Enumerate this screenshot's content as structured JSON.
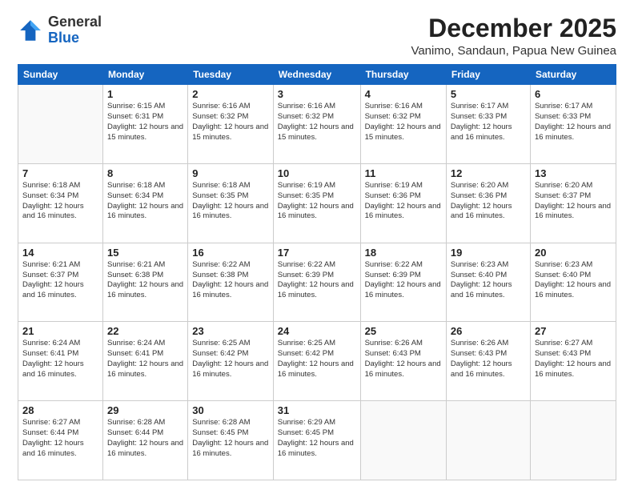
{
  "logo": {
    "general": "General",
    "blue": "Blue"
  },
  "header": {
    "month": "December 2025",
    "location": "Vanimo, Sandaun, Papua New Guinea"
  },
  "days_of_week": [
    "Sunday",
    "Monday",
    "Tuesday",
    "Wednesday",
    "Thursday",
    "Friday",
    "Saturday"
  ],
  "weeks": [
    [
      {
        "day": "",
        "info": ""
      },
      {
        "day": "1",
        "info": "Sunrise: 6:15 AM\nSunset: 6:31 PM\nDaylight: 12 hours\nand 15 minutes."
      },
      {
        "day": "2",
        "info": "Sunrise: 6:16 AM\nSunset: 6:32 PM\nDaylight: 12 hours\nand 15 minutes."
      },
      {
        "day": "3",
        "info": "Sunrise: 6:16 AM\nSunset: 6:32 PM\nDaylight: 12 hours\nand 15 minutes."
      },
      {
        "day": "4",
        "info": "Sunrise: 6:16 AM\nSunset: 6:32 PM\nDaylight: 12 hours\nand 15 minutes."
      },
      {
        "day": "5",
        "info": "Sunrise: 6:17 AM\nSunset: 6:33 PM\nDaylight: 12 hours\nand 16 minutes."
      },
      {
        "day": "6",
        "info": "Sunrise: 6:17 AM\nSunset: 6:33 PM\nDaylight: 12 hours\nand 16 minutes."
      }
    ],
    [
      {
        "day": "7",
        "info": ""
      },
      {
        "day": "8",
        "info": "Sunrise: 6:18 AM\nSunset: 6:34 PM\nDaylight: 12 hours\nand 16 minutes."
      },
      {
        "day": "9",
        "info": "Sunrise: 6:18 AM\nSunset: 6:35 PM\nDaylight: 12 hours\nand 16 minutes."
      },
      {
        "day": "10",
        "info": "Sunrise: 6:19 AM\nSunset: 6:35 PM\nDaylight: 12 hours\nand 16 minutes."
      },
      {
        "day": "11",
        "info": "Sunrise: 6:19 AM\nSunset: 6:36 PM\nDaylight: 12 hours\nand 16 minutes."
      },
      {
        "day": "12",
        "info": "Sunrise: 6:20 AM\nSunset: 6:36 PM\nDaylight: 12 hours\nand 16 minutes."
      },
      {
        "day": "13",
        "info": "Sunrise: 6:20 AM\nSunset: 6:37 PM\nDaylight: 12 hours\nand 16 minutes."
      }
    ],
    [
      {
        "day": "14",
        "info": ""
      },
      {
        "day": "15",
        "info": "Sunrise: 6:21 AM\nSunset: 6:38 PM\nDaylight: 12 hours\nand 16 minutes."
      },
      {
        "day": "16",
        "info": "Sunrise: 6:22 AM\nSunset: 6:38 PM\nDaylight: 12 hours\nand 16 minutes."
      },
      {
        "day": "17",
        "info": "Sunrise: 6:22 AM\nSunset: 6:39 PM\nDaylight: 12 hours\nand 16 minutes."
      },
      {
        "day": "18",
        "info": "Sunrise: 6:22 AM\nSunset: 6:39 PM\nDaylight: 12 hours\nand 16 minutes."
      },
      {
        "day": "19",
        "info": "Sunrise: 6:23 AM\nSunset: 6:40 PM\nDaylight: 12 hours\nand 16 minutes."
      },
      {
        "day": "20",
        "info": "Sunrise: 6:23 AM\nSunset: 6:40 PM\nDaylight: 12 hours\nand 16 minutes."
      }
    ],
    [
      {
        "day": "21",
        "info": ""
      },
      {
        "day": "22",
        "info": "Sunrise: 6:24 AM\nSunset: 6:41 PM\nDaylight: 12 hours\nand 16 minutes."
      },
      {
        "day": "23",
        "info": "Sunrise: 6:25 AM\nSunset: 6:42 PM\nDaylight: 12 hours\nand 16 minutes."
      },
      {
        "day": "24",
        "info": "Sunrise: 6:25 AM\nSunset: 6:42 PM\nDaylight: 12 hours\nand 16 minutes."
      },
      {
        "day": "25",
        "info": "Sunrise: 6:26 AM\nSunset: 6:43 PM\nDaylight: 12 hours\nand 16 minutes."
      },
      {
        "day": "26",
        "info": "Sunrise: 6:26 AM\nSunset: 6:43 PM\nDaylight: 12 hours\nand 16 minutes."
      },
      {
        "day": "27",
        "info": "Sunrise: 6:27 AM\nSunset: 6:43 PM\nDaylight: 12 hours\nand 16 minutes."
      }
    ],
    [
      {
        "day": "28",
        "info": "Sunrise: 6:27 AM\nSunset: 6:44 PM\nDaylight: 12 hours\nand 16 minutes."
      },
      {
        "day": "29",
        "info": "Sunrise: 6:28 AM\nSunset: 6:44 PM\nDaylight: 12 hours\nand 16 minutes."
      },
      {
        "day": "30",
        "info": "Sunrise: 6:28 AM\nSunset: 6:45 PM\nDaylight: 12 hours\nand 16 minutes."
      },
      {
        "day": "31",
        "info": "Sunrise: 6:29 AM\nSunset: 6:45 PM\nDaylight: 12 hours\nand 16 minutes."
      },
      {
        "day": "",
        "info": ""
      },
      {
        "day": "",
        "info": ""
      },
      {
        "day": "",
        "info": ""
      }
    ]
  ],
  "week7_sun_info": "Sunrise: 6:18 AM\nSunset: 6:34 PM\nDaylight: 12 hours\nand 16 minutes.",
  "week14_sun_info": "Sunrise: 6:21 AM\nSunset: 6:37 PM\nDaylight: 12 hours\nand 16 minutes.",
  "week21_sun_info": "Sunrise: 6:24 AM\nSunset: 6:41 PM\nDaylight: 12 hours\nand 16 minutes."
}
